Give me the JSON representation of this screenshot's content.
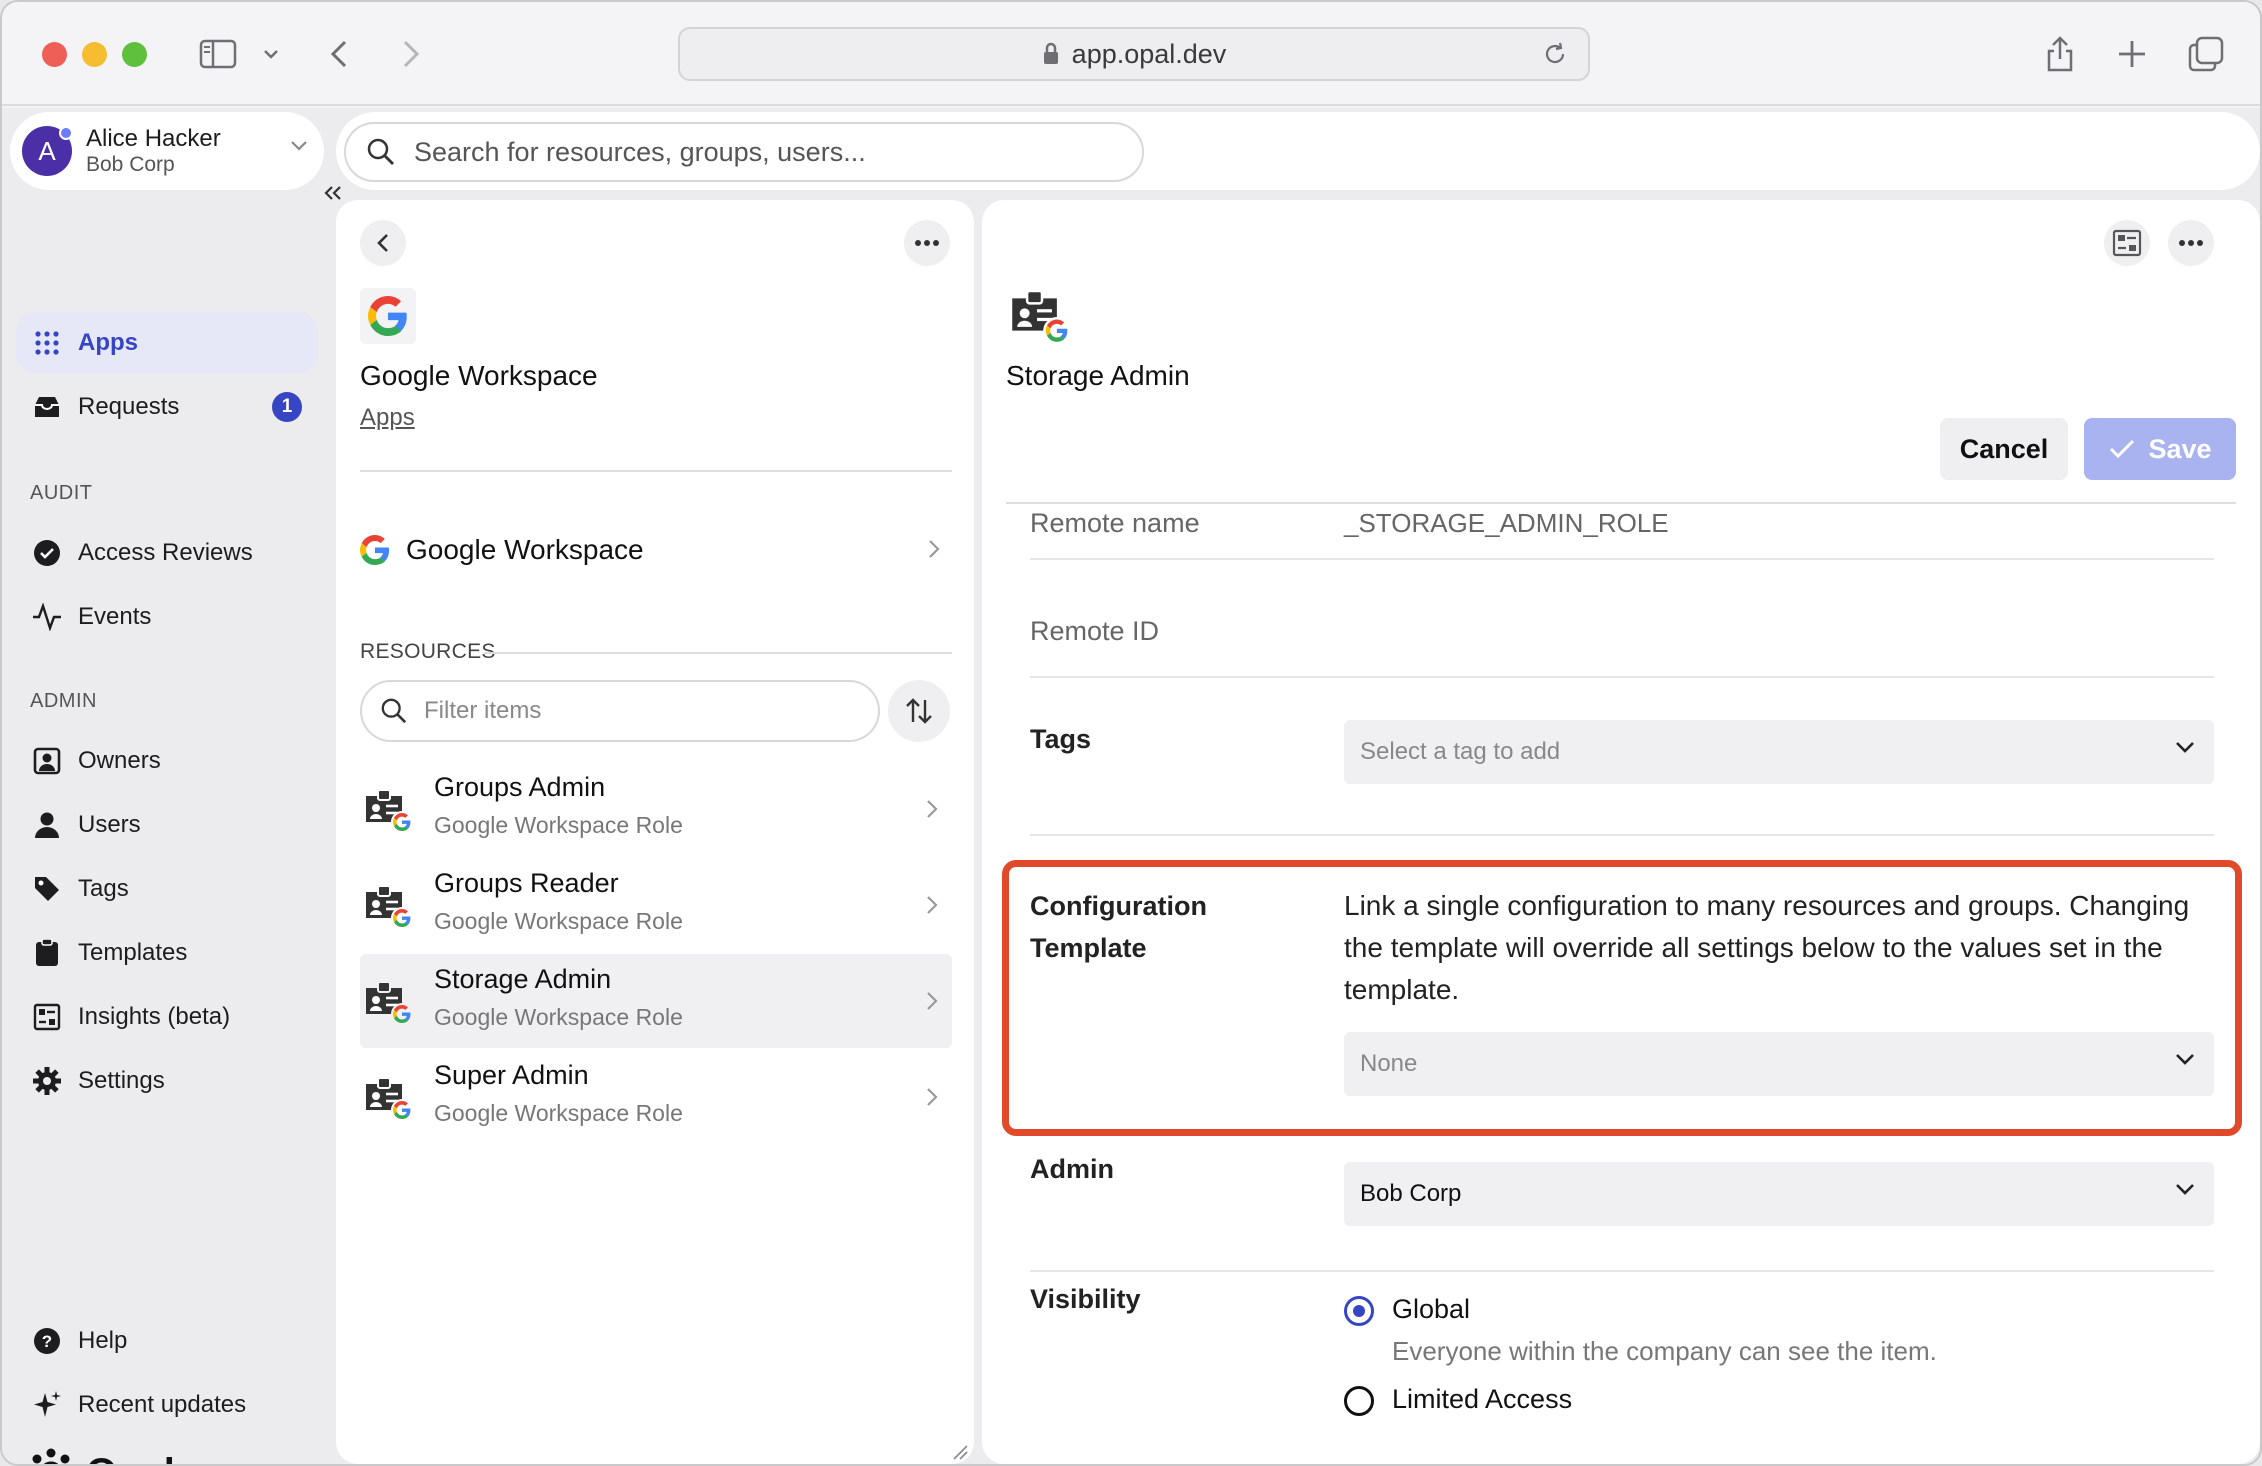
{
  "browser": {
    "url": "app.opal.dev"
  },
  "account": {
    "initial": "A",
    "name": "Alice Hacker",
    "org": "Bob Corp"
  },
  "search": {
    "placeholder": "Search for resources, groups, users..."
  },
  "sidebar": {
    "items": [
      {
        "label": "Apps",
        "icon": "grid-icon",
        "active": true
      },
      {
        "label": "Requests",
        "icon": "inbox-icon",
        "badge": "1"
      }
    ],
    "audit_label": "AUDIT",
    "audit_items": [
      {
        "label": "Access Reviews",
        "icon": "check-circle-icon"
      },
      {
        "label": "Events",
        "icon": "activity-icon"
      }
    ],
    "admin_label": "ADMIN",
    "admin_items": [
      {
        "label": "Owners",
        "icon": "owner-icon"
      },
      {
        "label": "Users",
        "icon": "user-icon"
      },
      {
        "label": "Tags",
        "icon": "tag-icon"
      },
      {
        "label": "Templates",
        "icon": "clipboard-icon"
      },
      {
        "label": "Insights (beta)",
        "icon": "insights-icon"
      },
      {
        "label": "Settings",
        "icon": "gear-icon"
      }
    ],
    "footer_items": [
      {
        "label": "Help",
        "icon": "help-icon"
      },
      {
        "label": "Recent updates",
        "icon": "sparkle-icon"
      }
    ],
    "logo_text": "Opal"
  },
  "middle": {
    "app_name": "Google Workspace",
    "breadcrumb": "Apps",
    "app_row_label": "Google Workspace",
    "resources_label": "RESOURCES",
    "filter_placeholder": "Filter items",
    "resources": [
      {
        "name": "Groups Admin",
        "type": "Google Workspace Role",
        "selected": false
      },
      {
        "name": "Groups Reader",
        "type": "Google Workspace Role",
        "selected": false
      },
      {
        "name": "Storage Admin",
        "type": "Google Workspace Role",
        "selected": true
      },
      {
        "name": "Super Admin",
        "type": "Google Workspace Role",
        "selected": false
      }
    ]
  },
  "detail": {
    "title": "Storage Admin",
    "cancel_label": "Cancel",
    "save_label": "Save",
    "remote_name_label": "Remote name",
    "remote_name_value": "_STORAGE_ADMIN_ROLE",
    "remote_id_label": "Remote ID",
    "tags_label": "Tags",
    "tags_placeholder": "Select a tag to add",
    "config_label_line1": "Configuration",
    "config_label_line2": "Template",
    "config_desc": "Link a single configuration to many resources and groups. Changing the template will override all settings below to the values set in the template.",
    "config_value": "None",
    "admin_label": "Admin",
    "admin_value": "Bob Corp",
    "visibility_label": "Visibility",
    "visibility_options": [
      {
        "label": "Global",
        "desc": "Everyone within the company can see the item.",
        "checked": true
      },
      {
        "label": "Limited Access",
        "checked": false
      }
    ]
  },
  "colors": {
    "accent": "#3545c4",
    "highlight": "#e04a2b",
    "save_disabled": "#a9b3ef"
  }
}
